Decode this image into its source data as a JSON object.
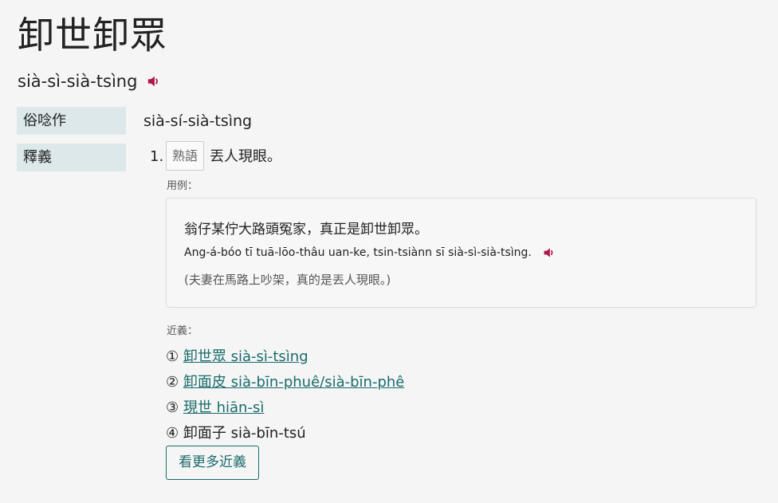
{
  "entry": {
    "title": "卸世卸眾",
    "romanization": "sià-sì-sià-tsìng"
  },
  "fields": {
    "alt_pron_label": "俗唸作",
    "alt_pron_value": "sià-sí-sià-tsìng",
    "definition_label": "釋義"
  },
  "definition": {
    "number": "1.",
    "tag": "熟語",
    "text": "丟人現眼。"
  },
  "example": {
    "label": "用例：",
    "han": "翁仔某佇大路頭冤家，真正是卸世卸眾。",
    "romanization": "Ang-á-bóo tī tuā-lōo-thâu uan-ke, tsin-tsiànn sī sià-sì-sià-tsìng.",
    "translation": "(夫妻在馬路上吵架，真的是丟人現眼。)"
  },
  "synonyms": {
    "label": "近義：",
    "items": [
      {
        "marker": "①",
        "text": "卸世眾 sià-sì-tsìng",
        "link": true
      },
      {
        "marker": "②",
        "text": "卸面皮 sià-bīn-phuê/sià-bīn-phê",
        "link": true
      },
      {
        "marker": "③",
        "text": "現世 hiān-sì",
        "link": true
      },
      {
        "marker": "④",
        "text": "卸面子 sià-bīn-tsú",
        "link": false
      }
    ],
    "more_button": "看更多近義"
  },
  "colors": {
    "accent": "#1a6b6b",
    "speaker": "#b0174a",
    "label_bg": "#dde8ea"
  },
  "icons": {
    "audio": "speaker-icon"
  }
}
